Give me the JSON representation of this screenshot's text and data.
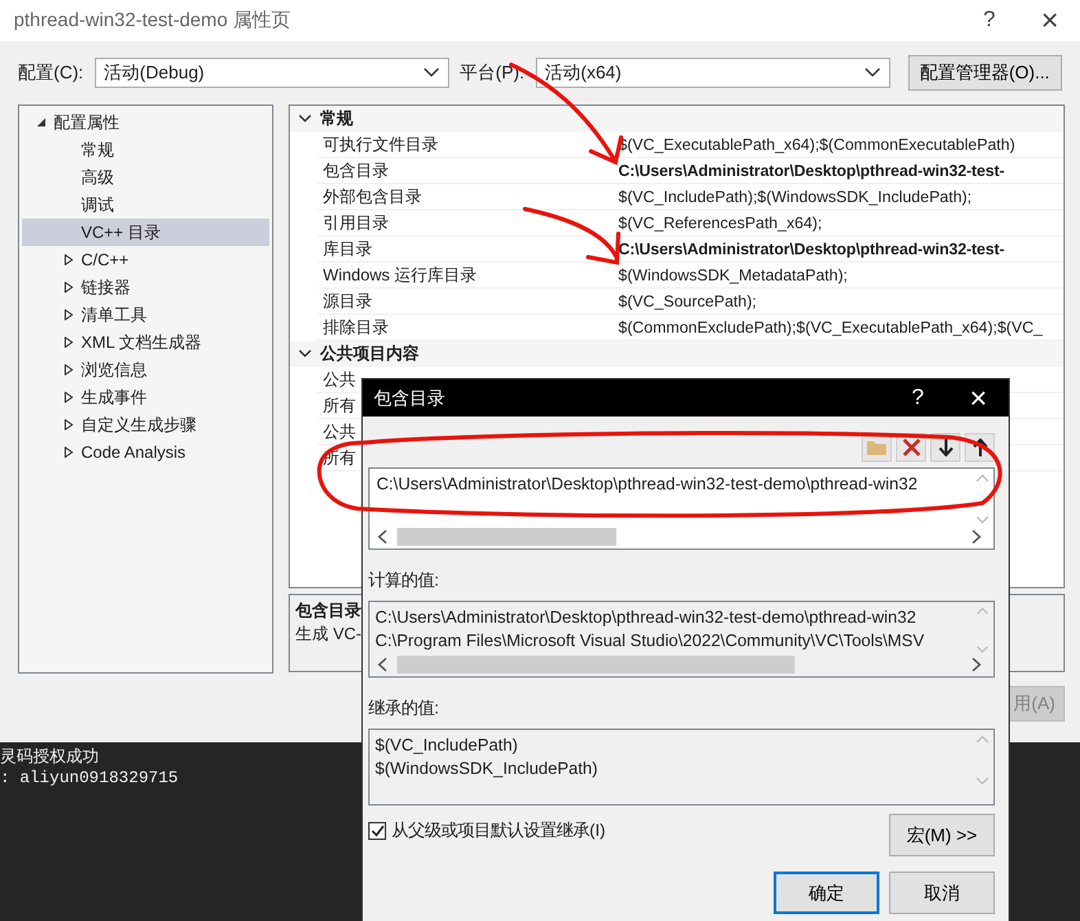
{
  "window": {
    "title": "pthread-win32-test-demo 属性页",
    "help": "?",
    "close": "×"
  },
  "toolbar": {
    "config_label": "配置(C):",
    "config_value": "活动(Debug)",
    "platform_label": "平台(P):",
    "platform_value": "活动(x64)",
    "manager_button": "配置管理器(O)..."
  },
  "tree": [
    {
      "label": "配置属性",
      "kind": "group",
      "expanded": true,
      "selected": false,
      "children": [
        {
          "label": "常规",
          "kind": "page",
          "selected": false
        },
        {
          "label": "高级",
          "kind": "page",
          "selected": false
        },
        {
          "label": "调试",
          "kind": "page",
          "selected": false
        },
        {
          "label": "VC++ 目录",
          "kind": "page",
          "selected": true
        },
        {
          "label": "C/C++",
          "kind": "group",
          "expanded": false,
          "selected": false
        },
        {
          "label": "链接器",
          "kind": "group",
          "expanded": false,
          "selected": false
        },
        {
          "label": "清单工具",
          "kind": "group",
          "expanded": false,
          "selected": false
        },
        {
          "label": "XML 文档生成器",
          "kind": "group",
          "expanded": false,
          "selected": false
        },
        {
          "label": "浏览信息",
          "kind": "group",
          "expanded": false,
          "selected": false
        },
        {
          "label": "生成事件",
          "kind": "group",
          "expanded": false,
          "selected": false
        },
        {
          "label": "自定义生成步骤",
          "kind": "group",
          "expanded": false,
          "selected": false
        },
        {
          "label": "Code Analysis",
          "kind": "group",
          "expanded": false,
          "selected": false
        }
      ]
    }
  ],
  "grid": {
    "sections": [
      {
        "title": "常规",
        "expanded": true,
        "rows": [
          {
            "name": "可执行文件目录",
            "value": "$(VC_ExecutablePath_x64);$(CommonExecutablePath)",
            "modified": false
          },
          {
            "name": "包含目录",
            "value": "C:\\Users\\Administrator\\Desktop\\pthread-win32-test-",
            "modified": true
          },
          {
            "name": "外部包含目录",
            "value": "$(VC_IncludePath);$(WindowsSDK_IncludePath);",
            "modified": false
          },
          {
            "name": "引用目录",
            "value": "$(VC_ReferencesPath_x64);",
            "modified": false
          },
          {
            "name": "库目录",
            "value": "C:\\Users\\Administrator\\Desktop\\pthread-win32-test-",
            "modified": true
          },
          {
            "name": "Windows 运行库目录",
            "value": "$(WindowsSDK_MetadataPath);",
            "modified": false
          },
          {
            "name": "源目录",
            "value": "$(VC_SourcePath);",
            "modified": false
          },
          {
            "name": "排除目录",
            "value": "$(CommonExcludePath);$(VC_ExecutablePath_x64);$(VC_",
            "modified": false
          }
        ]
      },
      {
        "title": "公共项目内容",
        "expanded": true,
        "rows": [
          {
            "name": "公共"
          },
          {
            "name": "所有"
          },
          {
            "name": "公共"
          },
          {
            "name": "所有"
          }
        ]
      }
    ]
  },
  "description": {
    "title": "包含目录",
    "text": "生成 VC-"
  },
  "apply_button": {
    "label": "用(A)",
    "disabled": true
  },
  "console": {
    "lines": [
      "灵码授权成功",
      ":  aliyun0918329715"
    ]
  },
  "dialog": {
    "title": "包含目录",
    "help": "?",
    "close": "×",
    "entries": [
      "C:\\Users\\Administrator\\Desktop\\pthread-win32-test-demo\\pthread-win32"
    ],
    "computed_label": "计算的值:",
    "computed": [
      "C:\\Users\\Administrator\\Desktop\\pthread-win32-test-demo\\pthread-win32",
      "C:\\Program Files\\Microsoft Visual Studio\\2022\\Community\\VC\\Tools\\MSV"
    ],
    "inherited_label": "继承的值:",
    "inherited": [
      "$(VC_IncludePath)",
      "$(WindowsSDK_IncludePath)"
    ],
    "inherit_checkbox": {
      "label": "从父级或项目默认设置继承(I)",
      "checked": true
    },
    "macro_button": "宏(M) >>",
    "ok_button": "确定",
    "cancel_button": "取消"
  }
}
